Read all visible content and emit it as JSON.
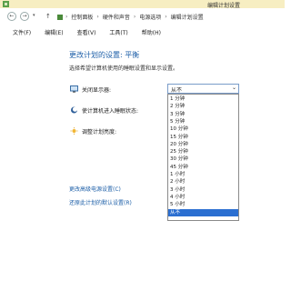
{
  "window": {
    "title": "编辑计划设置"
  },
  "breadcrumb": [
    "控制面板",
    "硬件和声音",
    "电源选项",
    "编辑计划设置"
  ],
  "menu": [
    "文件(F)",
    "编辑(E)",
    "查看(V)",
    "工具(T)",
    "帮助(H)"
  ],
  "page": {
    "title": "更改计划的设置: 平衡",
    "subtitle": "选择希望计算机使用的睡眠设置和显示设置。"
  },
  "settings": {
    "display_off_label": "关闭显示器:",
    "sleep_label": "使计算机进入睡眠状态:",
    "brightness_label": "调整计划亮度:"
  },
  "select": {
    "value": "从不",
    "options": [
      "1 分钟",
      "2 分钟",
      "3 分钟",
      "5 分钟",
      "10 分钟",
      "15 分钟",
      "20 分钟",
      "25 分钟",
      "30 分钟",
      "45 分钟",
      "1 小时",
      "2 小时",
      "3 小时",
      "4 小时",
      "5 小时",
      "从不"
    ]
  },
  "links": {
    "advanced": "更改高级电源设置(C)",
    "restore": "还原此计划的默认设置(R)"
  },
  "colors": {
    "accent": "#1d5fa8",
    "selection": "#2b6fd1",
    "titlebar": "#f7eec2"
  }
}
